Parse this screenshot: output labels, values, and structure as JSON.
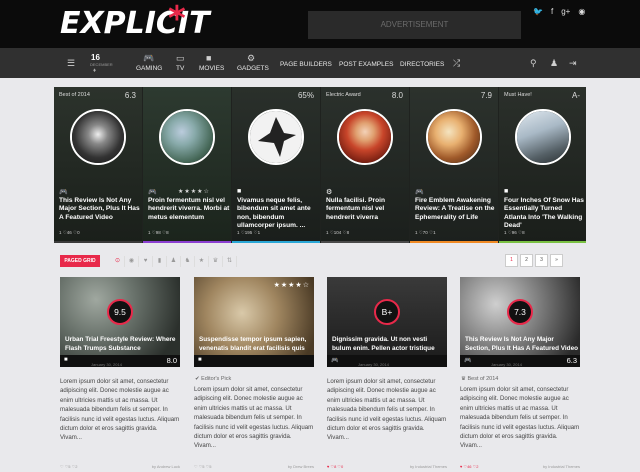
{
  "header": {
    "logo": "EXPLICIT",
    "logo_mark": "*",
    "ad_label": "ADVERTISEMENT",
    "social": [
      "twitter-icon",
      "facebook-icon",
      "google-plus-icon",
      "rss-icon"
    ]
  },
  "nav": {
    "date_day": "16",
    "date_month": "DECEMBER",
    "items": [
      {
        "label": "GAMING",
        "icon": "gamepad-icon"
      },
      {
        "label": "TV",
        "icon": "tv-icon"
      },
      {
        "label": "MOVIES",
        "icon": "video-icon"
      },
      {
        "label": "GADGETS",
        "icon": "gear-icon"
      },
      {
        "label": "PAGE BUILDERS"
      },
      {
        "label": "POST EXAMPLES"
      },
      {
        "label": "DIRECTORIES"
      }
    ]
  },
  "hero": [
    {
      "head": "Best of 2014",
      "score": "6.3",
      "icon": "gamepad-icon",
      "title": "This Review Is Not Any Major Section, Plus It Has A Featured Video",
      "meta": "1   ♡46   ♡0",
      "bar": "#3a3a3a"
    },
    {
      "head": "",
      "score": "",
      "icon": "gamepad-icon",
      "stars": "★★★★☆",
      "title": "Proin fermentum nisl vel hendrerit viverra. Morbi at metus elementum",
      "meta": "1   ♡98   ♡8",
      "bar": "#8b3fd1"
    },
    {
      "head": "",
      "score": "65%",
      "icon": "video-icon",
      "title": "Vivamus neque felis, bibendum sit amet ante non, bibendum ullamcorper ipsum. ...",
      "meta": "1   ♡195   ♡1",
      "bar": "#2aa7d6"
    },
    {
      "head": "Electric Award",
      "score": "8.0",
      "icon": "gear-icon",
      "title": "Nulla facilisi. Proin fermentum nisl vel hendrerit viverra",
      "meta": "1   ♡104   ♡8",
      "bar": "#4a4a4a"
    },
    {
      "head": "",
      "score": "7.9",
      "icon": "gamepad-icon",
      "title": "Fire Emblem Awakening Review: A Treatise on the Ephemerality of Life",
      "meta": "1   ♡70   ♡1",
      "bar": "#f08a24"
    },
    {
      "head": "Must Have!",
      "score": "A-",
      "icon": "video-icon",
      "title": "Four Inches Of Snow Has Essentially Turned Atlanta Into 'The Walking Dead'",
      "meta": "1   ♡96   ♡8",
      "bar": "#7ac143"
    }
  ],
  "filter": {
    "paged_label": "PAGED GRID",
    "icons": [
      "clock-icon",
      "eye-icon",
      "heart-icon",
      "chart-icon",
      "user-icon",
      "users-icon",
      "star-icon",
      "trophy-icon",
      "sort-icon"
    ],
    "pages": [
      "1",
      "2",
      "3",
      "»"
    ]
  },
  "cards": [
    {
      "badge": "9.5",
      "stars": "",
      "title": "Urban Trial Freestyle Review: Where Flash Trumps Substance",
      "score": "8.0",
      "date": "January 30, 2014",
      "pick": "",
      "body": "Lorem ipsum dolor sit amet, consectetur adipiscing elit. Donec molestie augue ac enim ultricies mattis ut ac massa. Ut malesuada bibendum felis ut semper. In facilisis nunc id velit egestas luctus. Aliquam dictum dolor et eros sagittis gravida. Vivam...",
      "foot_left": "♡  ♡5  ♡2",
      "by": "by Andrew Luck",
      "under": "#e8e8e8"
    },
    {
      "badge": "",
      "stars": "★★★★☆",
      "title": "Suspendisse tempor ipsum sapien, venenatis blandit erat facilisis quis",
      "score": "",
      "date": "",
      "pick": "Editor's Pick",
      "body": "Lorem ipsum dolor sit amet, consectetur adipiscing elit. Donec molestie augue ac enim ultricies mattis ut ac massa. Ut malesuada bibendum felis ut semper. In facilisis nunc id velit egestas luctus. Aliquam dictum dolor et eros sagittis gravida. Vivam...",
      "foot_left": "♡  ♡5  ♡5",
      "by": "by Drew Brees",
      "under": "#e8e8e8"
    },
    {
      "badge": "B+",
      "stars": "",
      "title": "Dignissim gravida. Ut non vesti bulum enim. Pellen actor tristique",
      "score": "",
      "date": "January 30, 2014",
      "pick": "",
      "body": "Lorem ipsum dolor sit amet, consectetur adipiscing elit. Donec molestie augue ac enim ultricies mattis ut ac massa. Ut malesuada bibendum felis ut semper. In facilisis nunc id velit egestas luctus. Aliquam dictum dolor et eros sagittis gravida. Vivam...",
      "foot_left": "♥  ♡8  ♡0",
      "by": "by Industrial Themes",
      "under": "#e8e8e8"
    },
    {
      "badge": "7.3",
      "stars": "",
      "title": "This Review Is Not Any Major Section, Plus It Has A Featured Video",
      "score": "6.3",
      "date": "January 30, 2014",
      "pick": "Best of 2014",
      "body": "Lorem ipsum dolor sit amet, consectetur adipiscing elit. Donec molestie augue ac enim ultricies mattis ut ac massa. Ut malesuada bibendum felis ut semper. In facilisis nunc id velit egestas luctus. Aliquam dictum dolor et eros sagittis gravida. Vivam...",
      "foot_left": "♥  ♡46  ♡2",
      "by": "by Industrial Themes",
      "under": "#e8e8e8"
    }
  ],
  "colors": {
    "accent": "#e8294a",
    "topbar": "#0b0b0b",
    "nav": "#303030"
  }
}
